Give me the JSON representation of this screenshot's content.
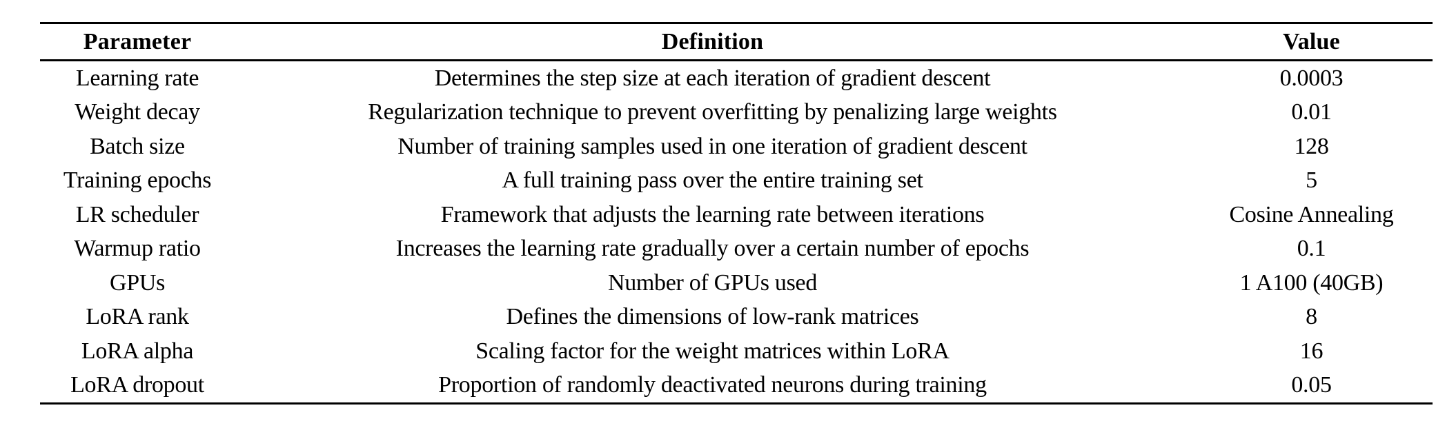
{
  "table": {
    "headers": {
      "parameter": "Parameter",
      "definition": "Definition",
      "value": "Value"
    },
    "rows": [
      {
        "parameter": "Learning rate",
        "definition": "Determines the step size at each iteration of gradient descent",
        "value": "0.0003"
      },
      {
        "parameter": "Weight decay",
        "definition": "Regularization technique to prevent overfitting by penalizing large weights",
        "value": "0.01"
      },
      {
        "parameter": "Batch size",
        "definition": "Number of training samples used in one iteration of gradient descent",
        "value": "128"
      },
      {
        "parameter": "Training epochs",
        "definition": "A full training pass over the entire training set",
        "value": "5"
      },
      {
        "parameter": "LR scheduler",
        "definition": "Framework that adjusts the learning rate between iterations",
        "value": "Cosine Annealing"
      },
      {
        "parameter": "Warmup ratio",
        "definition": "Increases the learning rate gradually over a certain number of epochs",
        "value": "0.1"
      },
      {
        "parameter": "GPUs",
        "definition": "Number of GPUs used",
        "value": "1 A100 (40GB)"
      },
      {
        "parameter": "LoRA rank",
        "definition": "Defines the dimensions of low-rank matrices",
        "value": "8"
      },
      {
        "parameter": "LoRA alpha",
        "definition": "Scaling factor for the weight matrices within LoRA",
        "value": "16"
      },
      {
        "parameter": "LoRA dropout",
        "definition": "Proportion of randomly deactivated neurons during training",
        "value": "0.05"
      }
    ]
  }
}
